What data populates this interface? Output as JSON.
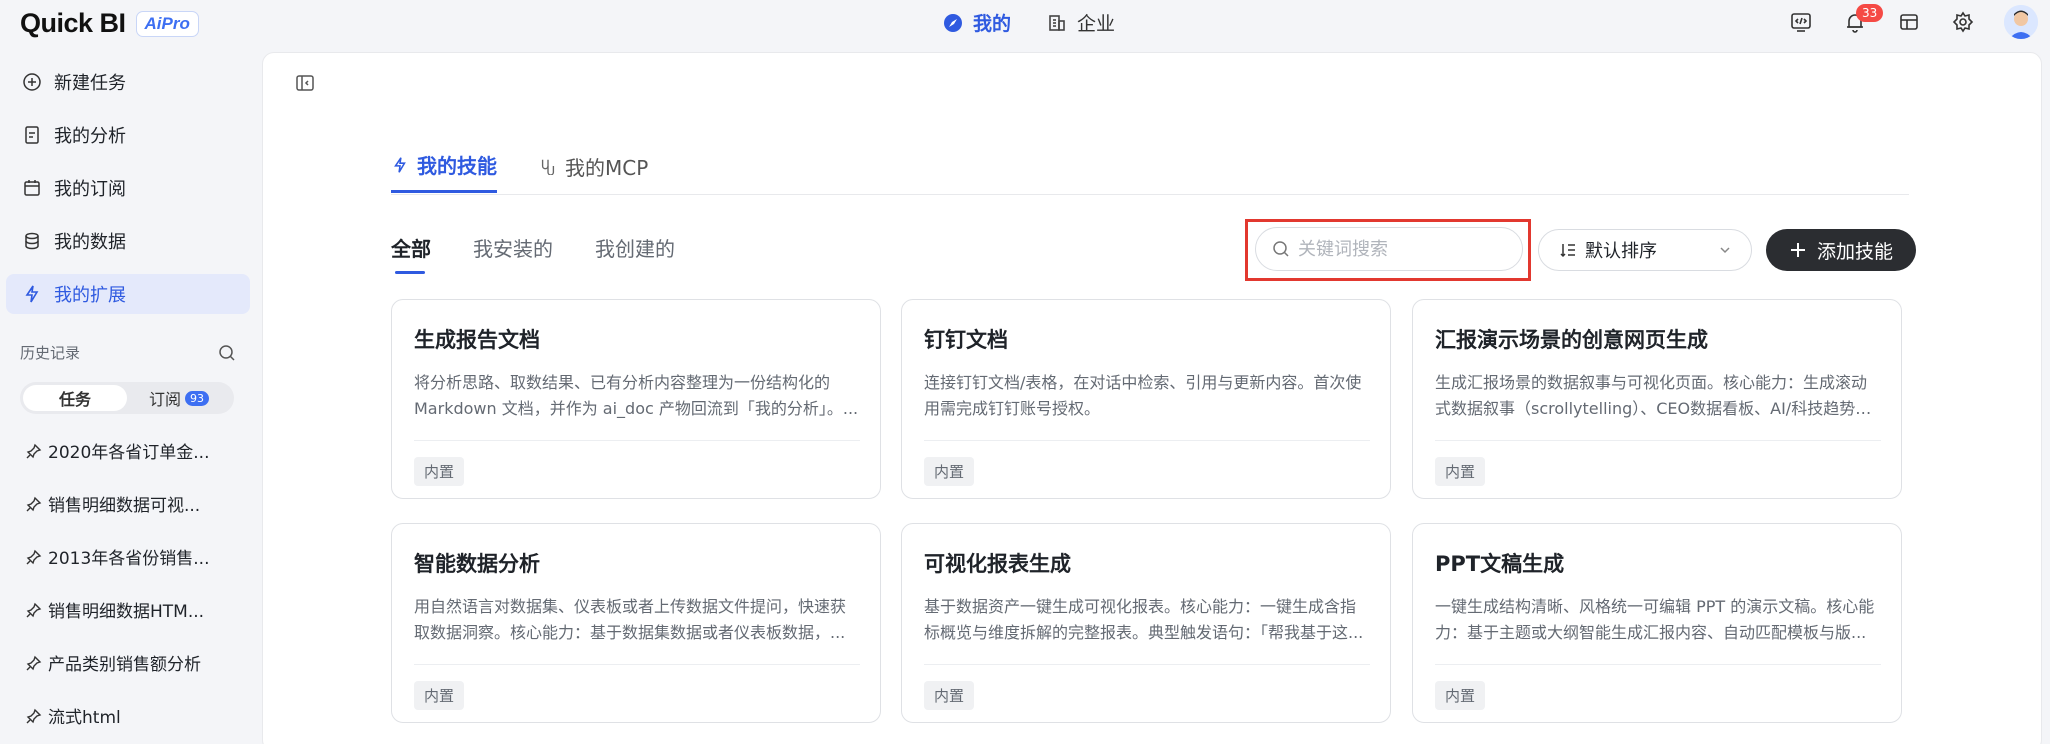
{
  "header": {
    "logo_text": "Quick BI",
    "logo_badge": "AiPro",
    "nav": [
      {
        "label": "我的",
        "active": true
      },
      {
        "label": "企业",
        "active": false
      }
    ],
    "notification_count": "33"
  },
  "sidebar": {
    "items": [
      {
        "label": "新建任务",
        "icon": "plus-chat-icon"
      },
      {
        "label": "我的分析",
        "icon": "document-icon"
      },
      {
        "label": "我的订阅",
        "icon": "calendar-icon"
      },
      {
        "label": "我的数据",
        "icon": "database-icon"
      },
      {
        "label": "我的扩展",
        "icon": "lightning-icon",
        "active": true
      }
    ],
    "history_title": "历史记录",
    "segment": {
      "task_label": "任务",
      "subscribe_label": "订阅",
      "subscribe_count": "93"
    },
    "history": [
      "2020年各省订单金...",
      "销售明细数据可视...",
      "2013年各省份销售...",
      "销售明细数据HTM...",
      "产品类别销售额分析",
      "流式html"
    ]
  },
  "main": {
    "tabs": [
      {
        "label": "我的技能",
        "active": true
      },
      {
        "label": "我的MCP",
        "active": false
      }
    ],
    "filters": [
      {
        "label": "全部",
        "active": true
      },
      {
        "label": "我安装的",
        "active": false
      },
      {
        "label": "我创建的",
        "active": false
      }
    ],
    "search_placeholder": "关键词搜索",
    "sort_label": "默认排序",
    "add_label": "添加技能",
    "cards": [
      {
        "title": "生成报告文档",
        "desc": "将分析思路、取数结果、已有分析内容整理为一份结构化的 Markdown 文档，并作为 ai_doc 产物回流到「我的分析」。...",
        "tag": "内置"
      },
      {
        "title": "钉钉文档",
        "desc": "连接钉钉文档/表格，在对话中检索、引用与更新内容。首次使用需完成钉钉账号授权。",
        "tag": "内置"
      },
      {
        "title": "汇报演示场景的创意网页生成",
        "desc": "生成汇报场景的数据叙事与可视化页面。核心能力：生成滚动式数据叙事（scrollytelling）、CEO数据看板、AI/科技趋势可...",
        "tag": "内置"
      },
      {
        "title": "智能数据分析",
        "desc": "用自然语言对数据集、仪表板或者上传数据文件提问，快速获取数据洞察。核心能力：基于数据集数据或者仪表板数据，...",
        "tag": "内置"
      },
      {
        "title": "可视化报表生成",
        "desc": "基于数据资产一键生成可视化报表。核心能力：一键生成含指标概览与维度拆解的完整报表。典型触发语句：「帮我基于这...",
        "tag": "内置"
      },
      {
        "title": "PPT文稿生成",
        "desc": "一键生成结构清晰、风格统一可编辑 PPT 的演示文稿。核心能力：基于主题或大纲智能生成汇报内容、自动匹配模板与版...",
        "tag": "内置"
      }
    ]
  }
}
